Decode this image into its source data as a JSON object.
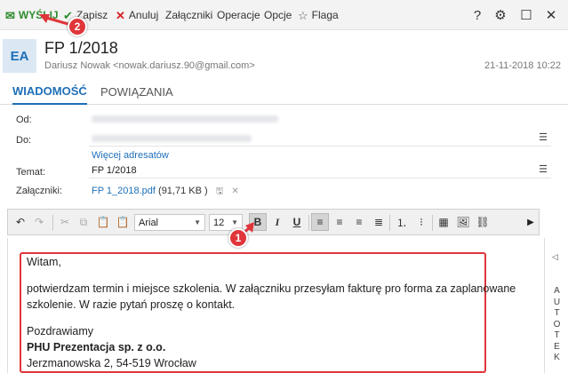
{
  "toolbar": {
    "send_label": "WYŚLIJ",
    "save_label": "Zapisz",
    "cancel_label": "Anuluj",
    "attachments_label": "Załączniki",
    "operations_label": "Operacje",
    "options_label": "Opcje",
    "flag_label": "Flaga",
    "help_glyph": "?",
    "settings_glyph": "⚙",
    "maximize_glyph": "☐",
    "close_glyph": "✕"
  },
  "header": {
    "avatar_initials": "EA",
    "subject": "FP 1/2018",
    "sender": "Dariusz Nowak <nowak.dariusz.90@gmail.com>",
    "date": "21-11-2018 10:22"
  },
  "tabs": [
    {
      "label": "WIADOMOŚĆ",
      "active": true
    },
    {
      "label": "POWIĄZANIA",
      "active": false
    }
  ],
  "form": {
    "from_label": "Od:",
    "to_label": "Do:",
    "more_recipients": "Więcej adresatów",
    "subject_label": "Temat:",
    "subject_value": "FP 1/2018",
    "attachments_label": "Załączniki:",
    "attachment_name": "FP 1_2018.pdf",
    "attachment_size": "(91,71 KB )"
  },
  "editor": {
    "font_name": "Arial",
    "font_size": "12"
  },
  "body": {
    "greeting": "Witam,",
    "line1": "potwierdzam termin i miejsce szkolenia. W załączniku przesyłam fakturę pro forma za zaplanowane",
    "line2": "szkolenie. W razie pytań proszę o kontakt.",
    "regards": "Pozdrawiamy",
    "company": "PHU Prezentacja sp. z o.o.",
    "address": "Jerzmanowska 2, 54-519 Wrocław"
  },
  "side_panel": {
    "arrow": "◁",
    "letters": [
      "A",
      "U",
      "T",
      "O",
      "T",
      "E",
      "K"
    ]
  },
  "annotations": {
    "badge1": "1",
    "badge2": "2"
  },
  "colors": {
    "accent": "#1e6fb8",
    "send_green": "#2e8b2e",
    "highlight_red": "#e0353a"
  }
}
